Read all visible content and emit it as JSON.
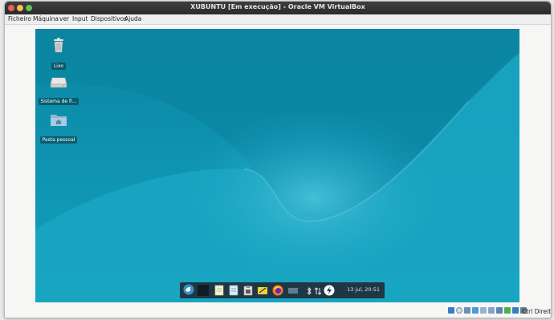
{
  "window": {
    "title": "XUBUNTU [Em execução] - Oracle VM VirtualBox"
  },
  "menu": [
    "Ficheiro",
    "Máquina",
    "ver",
    "Input",
    "Dispositivos",
    "Ajuda"
  ],
  "desktop": {
    "icons": [
      {
        "label": "Lixo",
        "icon": "trash-icon"
      },
      {
        "label": "Sistema de fi...",
        "icon": "drive-icon"
      },
      {
        "label": "Pasta pessoal",
        "icon": "home-folder-icon"
      }
    ],
    "background_color": "#0e93ad"
  },
  "panel": {
    "launchers": [
      "whisker-menu-icon",
      "show-desktop-icon",
      "files-icon",
      "notes-icon",
      "clipboard-icon",
      "mail-icon",
      "firefox-icon",
      "screen-icon"
    ],
    "tray": [
      "bluetooth-icon",
      "network-icon",
      "power-icon"
    ],
    "clock": "13 jul, 20:51"
  },
  "statusbar": {
    "host_key": "Ctrl Direito"
  }
}
